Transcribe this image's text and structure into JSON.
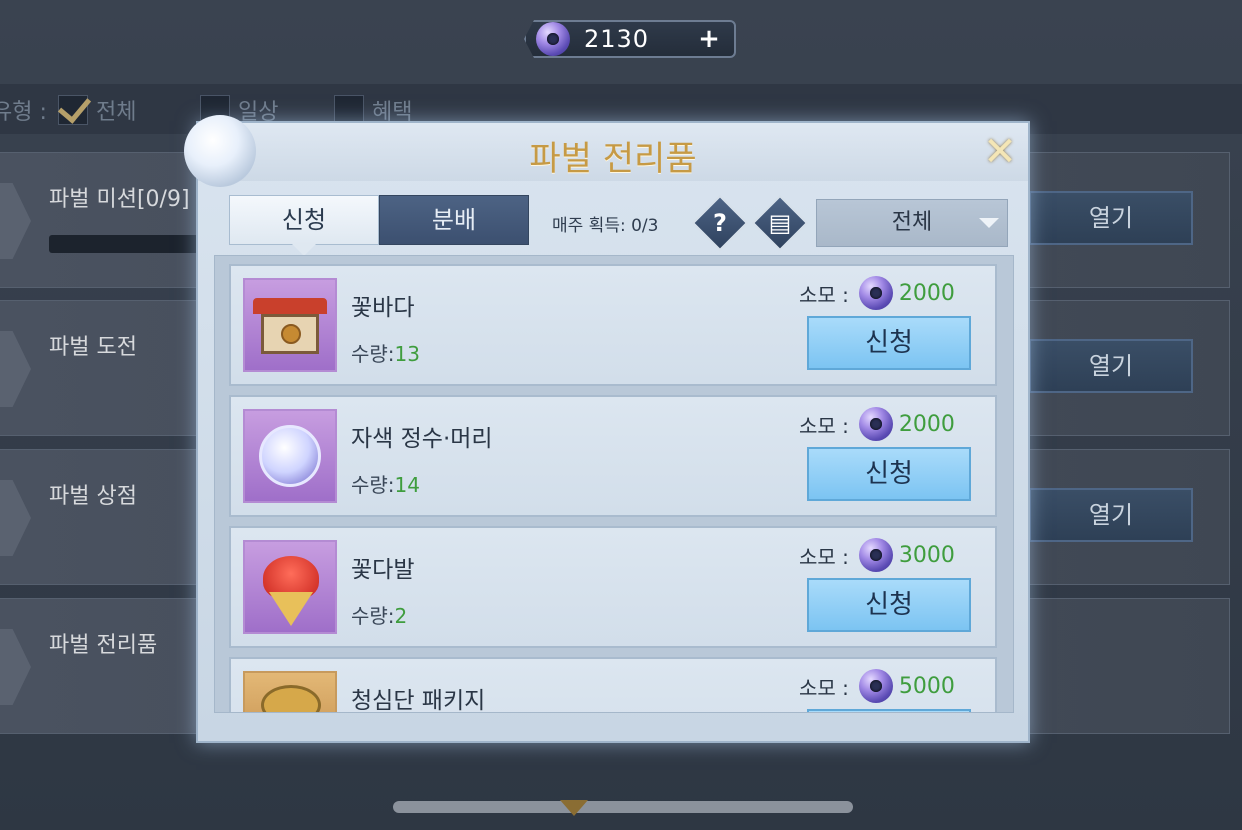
{
  "top_bar": {
    "currency_amount": "2130",
    "plus_label": "+"
  },
  "filter": {
    "type_label": "유형 :",
    "options": [
      {
        "label": "전체",
        "checked": true
      },
      {
        "label": "일상",
        "checked": false
      },
      {
        "label": "혜택",
        "checked": false
      }
    ]
  },
  "background_rows": [
    {
      "title": "파벌 미션[0/9]",
      "button": "열기"
    },
    {
      "title": "파벌 도전",
      "button": "열기"
    },
    {
      "title": "파벌 상점",
      "button": "열기"
    },
    {
      "title": "파벌 전리품",
      "button": ""
    }
  ],
  "modal": {
    "title": "파벌 전리품",
    "close_label": "✕",
    "tabs": [
      {
        "label": "신청"
      },
      {
        "label": "분배"
      }
    ],
    "weekly_label": "매주 획득: 0/3",
    "help_label": "?",
    "log_label": "▤",
    "dropdown_value": "전체",
    "items": [
      {
        "name": "꽃바다",
        "qty_label": "수량:",
        "qty": "13",
        "cost_label": "소모 :",
        "cost": "2000",
        "button": "신청"
      },
      {
        "name": "자색 정수·머리",
        "qty_label": "수량:",
        "qty": "14",
        "cost_label": "소모 :",
        "cost": "2000",
        "button": "신청"
      },
      {
        "name": "꽃다발",
        "qty_label": "수량:",
        "qty": "2",
        "cost_label": "소모 :",
        "cost": "3000",
        "button": "신청"
      },
      {
        "name": "청심단 패키지",
        "qty_label": "",
        "qty": "",
        "cost_label": "소모 :",
        "cost": "5000",
        "button": ""
      }
    ]
  },
  "colors": {
    "title_gold": "#c69a45",
    "value_green": "#3f9d3e",
    "tab_active": "#f4f8fc",
    "tab_inactive": "#4d6384",
    "apply_button": "#a9dbfa"
  },
  "icons": [
    "currency-coin-icon",
    "plus-icon",
    "close-icon",
    "help-icon",
    "list-log-icon",
    "chevron-down-icon",
    "check-icon"
  ]
}
